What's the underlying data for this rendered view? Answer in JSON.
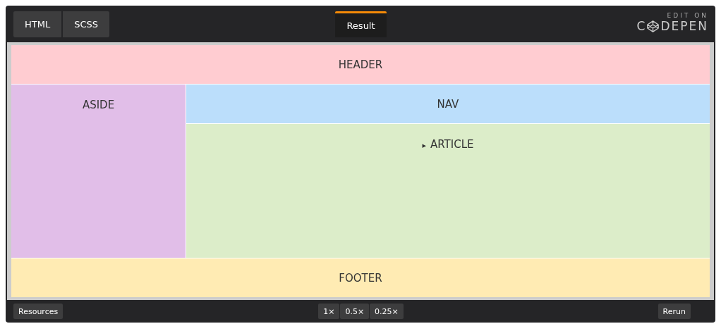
{
  "editor_tabs": [
    {
      "label": "HTML"
    },
    {
      "label": "SCSS"
    }
  ],
  "result_tab": {
    "label": "Result",
    "selected": true
  },
  "logo": {
    "caption": "EDIT ON",
    "first_letter": "C",
    "rest": "DEPEN"
  },
  "layout": {
    "header": "HEADER",
    "aside": "ASIDE",
    "nav": "NAV",
    "article": {
      "marker": "▸",
      "label": "ARTICLE"
    },
    "footer": "FOOTER"
  },
  "bottom_bar": {
    "resources": "Resources",
    "zoom": [
      "1×",
      "0.5×",
      "0.25×"
    ],
    "rerun": "Rerun"
  }
}
